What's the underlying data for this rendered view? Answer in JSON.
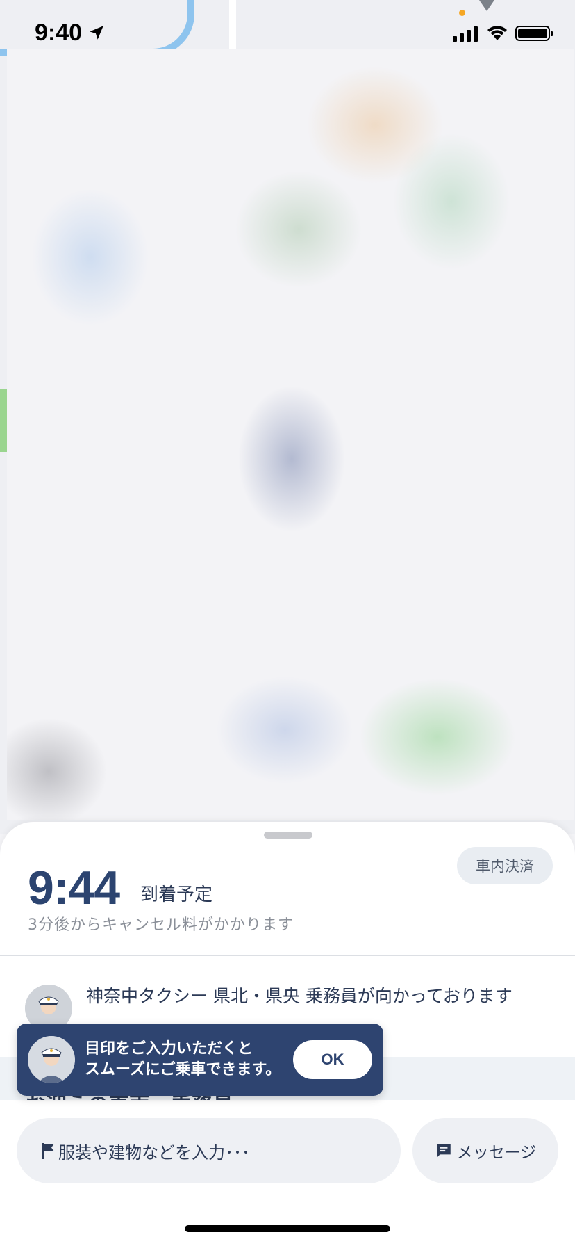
{
  "status_bar": {
    "time": "9:40",
    "icons": [
      "location-arrow-icon",
      "signal-icon",
      "wifi-icon",
      "battery-icon"
    ]
  },
  "map": {
    "description_colors": {
      "water": "#8ec4ee",
      "park": "#9ad58f"
    }
  },
  "ride": {
    "eta_time": "9:44",
    "eta_label": "到着予定",
    "payment_method": "車内決済",
    "cancel_note": "3分後からキャンセル料がかかります",
    "driver_message": "神奈中タクシー 県北・県央 乗務員が向かっております",
    "section_heading": "お迎えの車両・乗務員"
  },
  "toast": {
    "text": "目印をご入力いただくと\nスムーズにご乗車できます。",
    "ok_label": "OK"
  },
  "bottom_actions": {
    "landmark_placeholder": "服装や建物などを入力･･･",
    "message_label": "メッセージ"
  },
  "colors": {
    "primary": "#2c4470",
    "toast_bg": "#2e4470",
    "chip_bg": "#eef0f4",
    "muted_text": "#8a8f98"
  }
}
